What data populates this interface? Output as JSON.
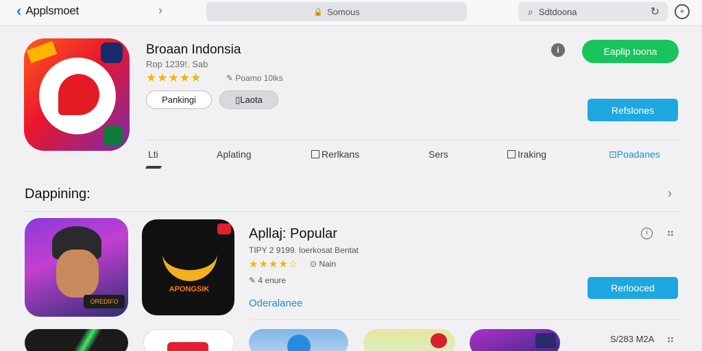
{
  "topbar": {
    "back_title": "Applsmoet",
    "url_text": "Somous",
    "search_text": "Sdtdoona"
  },
  "app": {
    "title": "Broaan Indonsia",
    "meta": "Rop 1239!. Sab",
    "stars": "★★★★★",
    "viewers": "Poamo 10lks",
    "pill1": "Pankingi",
    "pill2": "Laota",
    "get_label": "Eaplip toona",
    "refresh_label": "Refslones"
  },
  "tabs": [
    {
      "label": "Lti"
    },
    {
      "label": "Aplating"
    },
    {
      "label": "Rerlkans"
    },
    {
      "label": "Sers"
    },
    {
      "label": "Iraking"
    },
    {
      "label": "Poadanes"
    }
  ],
  "section": {
    "title": "Dappining:"
  },
  "popular": {
    "title": "Apllaj: Popular",
    "meta": "TIPY 2 9199. loerkosat Bentat",
    "stars": "★★★★☆",
    "views": "Nain",
    "size": "4 enure",
    "link": "Oderalanee",
    "button_label": "Rerlooced",
    "thumb1_label": "OREDIFO",
    "thumb2_label": "APONGSIK"
  },
  "bottom": {
    "size_label": "S/283 M2A"
  },
  "colors": {
    "accent_blue": "#1ea7e0",
    "green_button": "#19c45a",
    "star": "#f4b400"
  }
}
